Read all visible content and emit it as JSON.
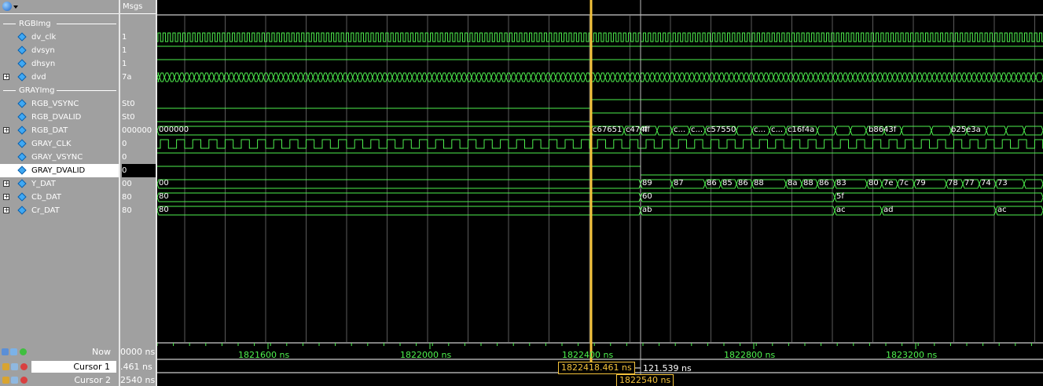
{
  "toolbar": {
    "menu_icon": "wave-menu-icon"
  },
  "header": {
    "msgs_label": "Msgs"
  },
  "signals": [
    {
      "type": "group",
      "name": "RGBImg"
    },
    {
      "type": "signal",
      "name": "dv_clk",
      "value": "1",
      "expandable": false
    },
    {
      "type": "signal",
      "name": "dvsyn",
      "value": "1",
      "expandable": false
    },
    {
      "type": "signal",
      "name": "dhsyn",
      "value": "1",
      "expandable": false
    },
    {
      "type": "signal",
      "name": "dvd",
      "value": "7a",
      "expandable": true
    },
    {
      "type": "group",
      "name": "GRAYImg"
    },
    {
      "type": "signal",
      "name": "RGB_VSYNC",
      "value": "St0",
      "expandable": false
    },
    {
      "type": "signal",
      "name": "RGB_DVALID",
      "value": "St0",
      "expandable": false
    },
    {
      "type": "signal",
      "name": "RGB_DAT",
      "value": "000000",
      "expandable": true
    },
    {
      "type": "signal",
      "name": "GRAY_CLK",
      "value": "0",
      "expandable": false
    },
    {
      "type": "signal",
      "name": "GRAY_VSYNC",
      "value": "0",
      "expandable": false
    },
    {
      "type": "signal",
      "name": "GRAY_DVALID",
      "value": "0",
      "expandable": false,
      "selected": true
    },
    {
      "type": "signal",
      "name": "Y_DAT",
      "value": "00",
      "expandable": true
    },
    {
      "type": "signal",
      "name": "Cb_DAT",
      "value": "80",
      "expandable": true
    },
    {
      "type": "signal",
      "name": "Cr_DAT",
      "value": "80",
      "expandable": true
    }
  ],
  "bus_labels": {
    "rgb_dat": [
      "000000",
      "c67651",
      "c474f",
      "4f",
      "c...",
      "c...",
      "c57550",
      "c...",
      "c...",
      "c16f4a",
      "b8643f",
      "b25e3a"
    ],
    "y_dat": [
      "00",
      "89",
      "87",
      "86",
      "85",
      "86",
      "88",
      "8a",
      "88",
      "86",
      "83",
      "80",
      "7e",
      "7c",
      "79",
      "78",
      "77",
      "74",
      "73"
    ],
    "cb_dat": [
      "80",
      "60",
      "5f"
    ],
    "cr_dat": [
      "80",
      "ab",
      "ac",
      "ad",
      "ac"
    ]
  },
  "bottom": {
    "now_label": "Now",
    "now_value": "0000 ns",
    "cursor1_label": "Cursor 1",
    "cursor1_value": ".461 ns",
    "cursor2_label": "Cursor 2",
    "cursor2_value": "2540 ns"
  },
  "timeline": {
    "ticks": [
      "1821600 ns",
      "1822000 ns",
      "1822400 ns",
      "1822800 ns",
      "1823200 ns"
    ],
    "cursor1_time": "1822418.461 ns",
    "cursor2_time": "1822540 ns",
    "delta": "121.539 ns"
  },
  "colors": {
    "wave": "#4ef14e",
    "cursor": "#f5c33b",
    "grid": "#5a5a5a",
    "panel": "#a0a0a0"
  }
}
